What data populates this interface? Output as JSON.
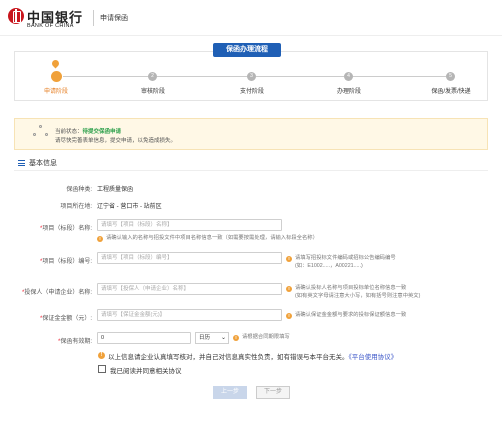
{
  "header": {
    "logo_cn": "中国银行",
    "logo_en": "BANK OF CHINA",
    "app_title": "申请保函",
    "colors": {
      "brand": "#c8161d"
    }
  },
  "flow": {
    "badge": "保函办理流程",
    "steps": [
      {
        "num": "",
        "label": "申请阶段",
        "active": true
      },
      {
        "num": "2",
        "label": "审核阶段",
        "active": false
      },
      {
        "num": "3",
        "label": "支付阶段",
        "active": false
      },
      {
        "num": "4",
        "label": "办理阶段",
        "active": false
      },
      {
        "num": "5",
        "label": "保函/发票/快递",
        "active": false
      }
    ],
    "colors": {
      "active": "#f0a13a",
      "inactive": "#b5b5b5",
      "badge": "#1f5fb5"
    }
  },
  "notice": {
    "prefix": "当前状态：",
    "status": "待提交保函申请",
    "line2": "请尽快完善表单信息，提交申请，以免造成损失。"
  },
  "section": {
    "title": "基本信息"
  },
  "form": {
    "guarantee_type_label": "保函种类:",
    "guarantee_type_value": "工程质量保函",
    "location_label": "项目所在地:",
    "location_value": "辽宁省 - 营口市 - 站前区",
    "project_name": {
      "label": "项目（标段）名称:",
      "placeholder": "请填写【项目（标段）名称】",
      "hint": "请确认输入的名称与招投文件中项目名称信息一致（如需要按需处理，请输入标段全名称）"
    },
    "project_code": {
      "label": "项目（标段）编号:",
      "placeholder": "请填写【项目（标段）编号】",
      "hint1": "请填写招投标文件编码或招标公告编码编号",
      "hint2": "(如：E1002.....，A00221.....)"
    },
    "insured": {
      "label": "投保人（申请企业）名称:",
      "placeholder": "请填写【投保人（申请企业）名称】",
      "hint1": "请确认投标人名称与项目投标单位名称信息一致",
      "hint2": "(如有英文字母请注意大小写，如有括号则注意中英文)"
    },
    "amount": {
      "label": "保证金金额（元）:",
      "placeholder": "请填写【保证金金额(元)】",
      "hint": "请确认保证金金额与要求的投标保证额信息一致"
    },
    "validity": {
      "label": "保函有效期:",
      "value": "0",
      "unit": "日历",
      "hint": "请根据合同期限填写"
    }
  },
  "declaration": {
    "text": "以上信息请企业认真填写核对，并自己对信息真实性负责，如有错误与本平台无关。",
    "link": "《平台使用协议》",
    "agree_label": "我已阅读并同意相关协议"
  },
  "buttons": {
    "prev": "上一步",
    "next": "下一步"
  }
}
